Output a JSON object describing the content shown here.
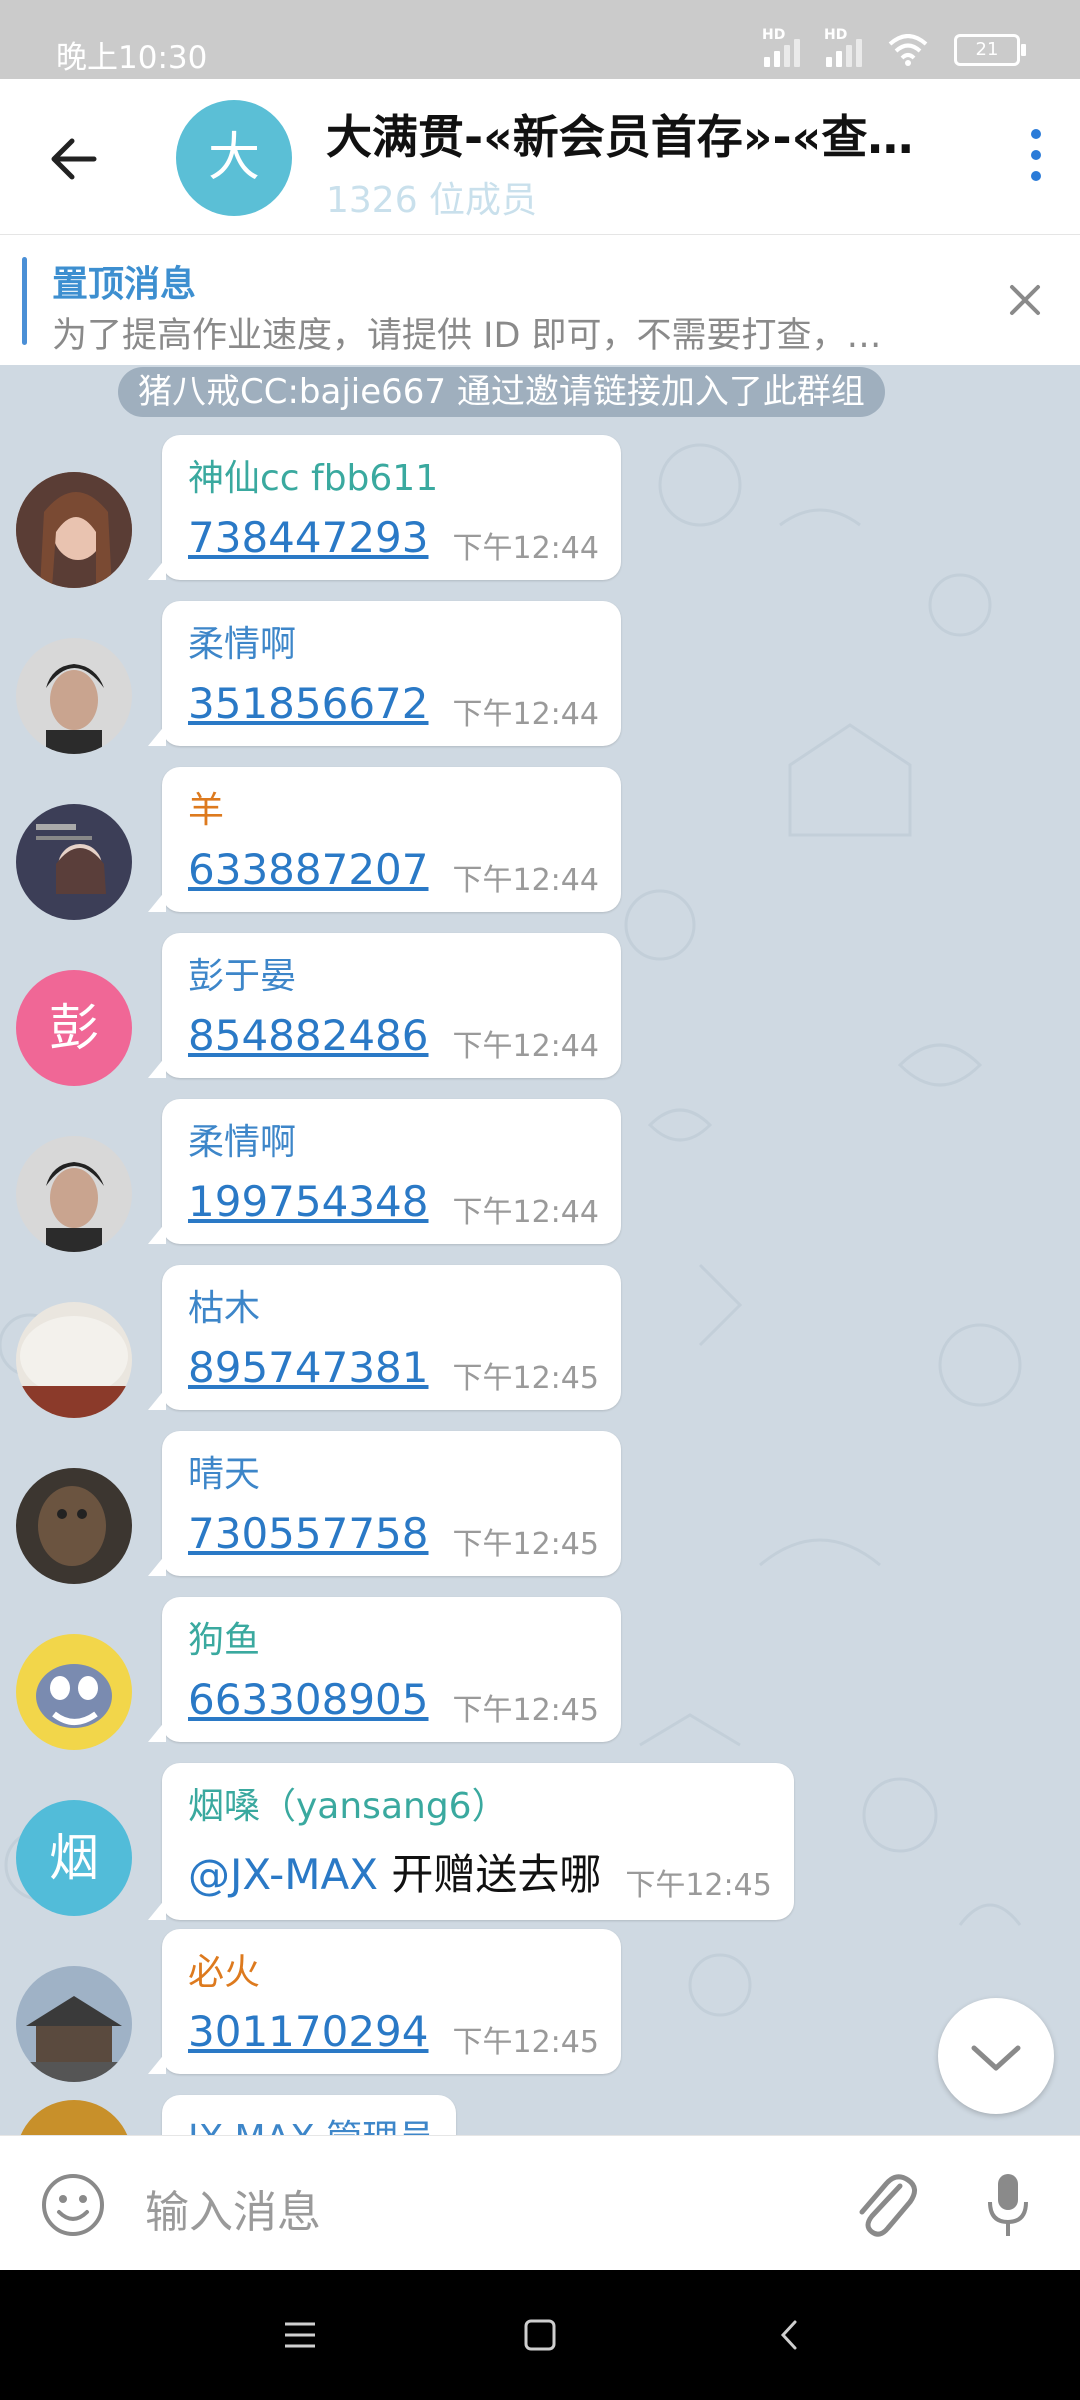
{
  "status": {
    "time": "晚上10:30",
    "hd1": "HD",
    "hd2": "HD",
    "battery": "21"
  },
  "header": {
    "avatar_letter": "大",
    "title": "大满贯-«新会员首存»-«查…",
    "members": "1326 位成员"
  },
  "pinned": {
    "title": "置顶消息",
    "text": "为了提高作业速度，请提供 ID 即可，不需要打查，…"
  },
  "service_message": "猪八戒CC:bajie667 通过邀请链接加入了此群组",
  "messages": [
    {
      "name": "神仙cc  fbb611",
      "name_color": "#3aa99f",
      "body": "738447293",
      "time": "下午12:44",
      "avatar": "photo-woman"
    },
    {
      "name": "柔情啊",
      "name_color": "#3d86c9",
      "body": "351856672",
      "time": "下午12:44",
      "avatar": "photo-man"
    },
    {
      "name": "羊",
      "name_color": "#dd7a1e",
      "body": "633887207",
      "time": "下午12:44",
      "avatar": "photo-anime"
    },
    {
      "name": "彭于晏",
      "name_color": "#3d86c9",
      "body": "854882486",
      "time": "下午12:44",
      "avatar_letter": "彭",
      "avatar_color": "#f06796"
    },
    {
      "name": "柔情啊",
      "name_color": "#3d86c9",
      "body": "199754348",
      "time": "下午12:44",
      "avatar": "photo-man"
    },
    {
      "name": "枯木",
      "name_color": "#3d86c9",
      "body": "895747381",
      "time": "下午12:45",
      "avatar": "photo-rice"
    },
    {
      "name": "晴天",
      "name_color": "#3d86c9",
      "body": "730557758",
      "time": "下午12:45",
      "avatar": "photo-bear"
    },
    {
      "name": "狗鱼",
      "name_color": "#3aa99f",
      "body": "663308905",
      "time": "下午12:45",
      "avatar": "photo-cartoon-cat"
    },
    {
      "name": "烟嗓（yansang6）",
      "name_color": "#3aa99f",
      "mention": "@JX-MAX",
      "body": " 开赠送去哪",
      "time": "下午12:45",
      "avatar_letter": "烟",
      "avatar_color": "#52bcd9"
    },
    {
      "name": "必火",
      "name_color": "#dd7a1e",
      "body": "301170294",
      "time": "下午12:45",
      "avatar": "photo-building"
    },
    {
      "name": "JX-MAX   管理员",
      "name_color": "#3d86c9",
      "body": "",
      "time": "",
      "avatar": "photo-partial"
    }
  ],
  "input": {
    "placeholder": "输入消息"
  },
  "icons": [
    "back-arrow-icon",
    "more-vert-icon",
    "close-icon",
    "chevron-down-icon",
    "emoji-icon",
    "attach-icon",
    "mic-icon",
    "nav-menu-icon",
    "nav-home-icon",
    "nav-back-icon"
  ]
}
